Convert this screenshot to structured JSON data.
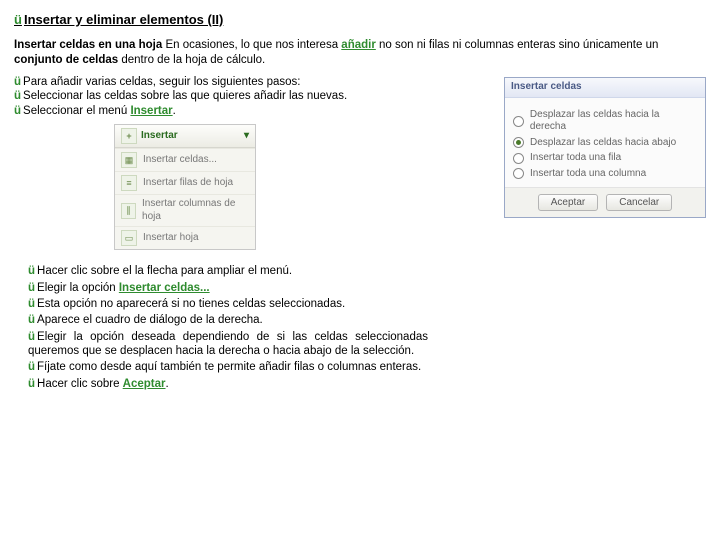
{
  "title": "Insertar y eliminar elementos (II)",
  "intro": {
    "lead": "Insertar celdas en una hoja",
    "rest_a": "  En ocasiones, lo que nos interesa ",
    "kw_add": "añadir",
    "rest_b": " no son ni filas ni columnas enteras sino únicamente un ",
    "kw_cells": "conjunto de celdas",
    "rest_c": " dentro de la hoja de cálculo."
  },
  "steps_top": [
    "Para añadir varias celdas, seguir los siguientes pasos:",
    "Seleccionar las celdas sobre las que quieres añadir las nuevas."
  ],
  "step_menu_a": "Seleccionar el menú ",
  "step_menu_kw": "Insertar",
  "step_menu_b": ".",
  "menu": {
    "head": "Insertar",
    "items": [
      "Insertar celdas...",
      "Insertar filas de hoja",
      "Insertar columnas de hoja",
      "Insertar hoja"
    ]
  },
  "dlg": {
    "title": "Insertar celdas",
    "options": [
      "Desplazar las celdas hacia la derecha",
      "Desplazar las celdas hacia abajo",
      "Insertar toda una fila",
      "Insertar toda una columna"
    ],
    "selected": 1,
    "ok": "Aceptar",
    "cancel": "Cancelar"
  },
  "steps_bottom": [
    {
      "t": "Hacer clic sobre el la flecha para ampliar el menú."
    },
    {
      "t_a": "Elegir la opción ",
      "kw": "Insertar celdas..."
    },
    {
      "t": "Esta opción no aparecerá si no tienes celdas seleccionadas."
    },
    {
      "t": "Aparece el cuadro de diálogo de la derecha."
    },
    {
      "t": "Elegir la opción deseada dependiendo de si las celdas seleccionadas queremos que se desplacen hacia la derecha o hacia abajo de la selección."
    },
    {
      "t": "Fíjate como desde aquí también te permite añadir filas o columnas enteras."
    },
    {
      "t_a": "Hacer clic sobre ",
      "kw": "Aceptar",
      "t_b": "."
    }
  ]
}
